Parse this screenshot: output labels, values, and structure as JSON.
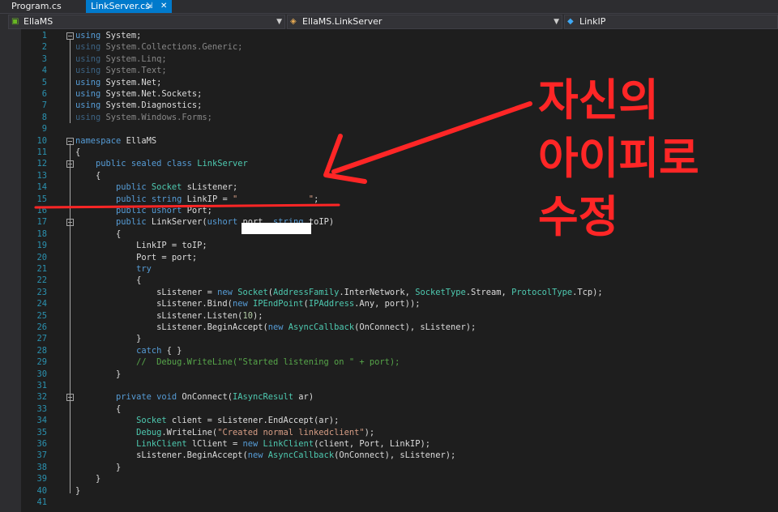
{
  "tabs": [
    {
      "label": "Program.cs",
      "active": false
    },
    {
      "label": "LinkServer.cs",
      "active": true
    }
  ],
  "nav": {
    "project": "EllaMS",
    "type": "EllaMS.LinkServer",
    "member": "LinkIP"
  },
  "lines": [
    {
      "n": "1",
      "html": "<span class=\"kw\">using</span> System;"
    },
    {
      "n": "2",
      "html": "<span class=\"dim\"><span class=\"kw\">using</span> System.Collections.Generic;</span>"
    },
    {
      "n": "3",
      "html": "<span class=\"dim\"><span class=\"kw\">using</span> System.Linq;</span>"
    },
    {
      "n": "4",
      "html": "<span class=\"dim\"><span class=\"kw\">using</span> System.Text;</span>"
    },
    {
      "n": "5",
      "html": "<span class=\"kw\">using</span> System.Net;"
    },
    {
      "n": "6",
      "html": "<span class=\"kw\">using</span> System.Net.Sockets;"
    },
    {
      "n": "7",
      "html": "<span class=\"kw\">using</span> System.Diagnostics;"
    },
    {
      "n": "8",
      "html": "<span class=\"dim\"><span class=\"kw\">using</span> System.Windows.Forms;</span>"
    },
    {
      "n": "9",
      "html": ""
    },
    {
      "n": "10",
      "html": "<span class=\"kw\">namespace</span> EllaMS"
    },
    {
      "n": "11",
      "html": "{"
    },
    {
      "n": "12",
      "html": "    <span class=\"kw\">public</span> <span class=\"kw\">sealed</span> <span class=\"kw\">class</span> <span class=\"ty\">LinkServer</span>"
    },
    {
      "n": "13",
      "html": "    {"
    },
    {
      "n": "14",
      "html": "        <span class=\"kw\">public</span> <span class=\"ty\">Socket</span> sListener;"
    },
    {
      "n": "15",
      "html": "        <span class=\"kw\">public</span> <span class=\"kw\">string</span> LinkIP = <span class=\"st\">\"              \"</span>;"
    },
    {
      "n": "16",
      "html": "        <span class=\"kw\">public</span> <span class=\"kw\">ushort</span> Port;"
    },
    {
      "n": "17",
      "html": "        <span class=\"kw\">public</span> LinkServer(<span class=\"kw\">ushort</span> port, <span class=\"kw\">string</span> toIP)"
    },
    {
      "n": "18",
      "html": "        {"
    },
    {
      "n": "19",
      "html": "            LinkIP = toIP;"
    },
    {
      "n": "20",
      "html": "            Port = port;"
    },
    {
      "n": "21",
      "html": "            <span class=\"kw\">try</span>"
    },
    {
      "n": "22",
      "html": "            {"
    },
    {
      "n": "23",
      "html": "                sListener = <span class=\"kw\">new</span> <span class=\"ty\">Socket</span>(<span class=\"ty\">AddressFamily</span>.InterNetwork, <span class=\"ty\">SocketType</span>.Stream, <span class=\"ty\">ProtocolType</span>.Tcp);"
    },
    {
      "n": "24",
      "html": "                sListener.Bind(<span class=\"kw\">new</span> <span class=\"ty\">IPEndPoint</span>(<span class=\"ty\">IPAddress</span>.Any, port));"
    },
    {
      "n": "25",
      "html": "                sListener.Listen(<span class=\"nm\">10</span>);"
    },
    {
      "n": "26",
      "html": "                sListener.BeginAccept(<span class=\"kw\">new</span> <span class=\"ty\">AsyncCallback</span>(OnConnect), sListener);"
    },
    {
      "n": "27",
      "html": "            }"
    },
    {
      "n": "28",
      "html": "            <span class=\"kw\">catch</span> { }"
    },
    {
      "n": "29",
      "html": "            <span class=\"cm\">//  Debug.WriteLine(\"Started listening on \" + port);</span>"
    },
    {
      "n": "30",
      "html": "        }"
    },
    {
      "n": "31",
      "html": ""
    },
    {
      "n": "32",
      "html": "        <span class=\"kw\">private</span> <span class=\"kw\">void</span> OnConnect(<span class=\"ty\">IAsyncResult</span> ar)"
    },
    {
      "n": "33",
      "html": "        {"
    },
    {
      "n": "34",
      "html": "            <span class=\"ty\">Socket</span> client = sListener.EndAccept(ar);"
    },
    {
      "n": "35",
      "html": "            <span class=\"ty\">Debug</span>.WriteLine(<span class=\"st\">\"Created normal linkedclient\"</span>);"
    },
    {
      "n": "36",
      "html": "            <span class=\"ty\">LinkClient</span> lClient = <span class=\"kw\">new</span> <span class=\"ty\">LinkClient</span>(client, Port, LinkIP);"
    },
    {
      "n": "37",
      "html": "            sListener.BeginAccept(<span class=\"kw\">new</span> <span class=\"ty\">AsyncCallback</span>(OnConnect), sListener);"
    },
    {
      "n": "38",
      "html": "        }"
    },
    {
      "n": "39",
      "html": "    }"
    },
    {
      "n": "40",
      "html": "}"
    },
    {
      "n": "41",
      "html": ""
    }
  ],
  "folds": [
    "1",
    "10",
    "12",
    "17",
    "32"
  ],
  "annotation": {
    "lines": [
      "자신의",
      "아이피로",
      "수정"
    ],
    "color": "#ff2626"
  },
  "colors": {
    "keyword": "#569cd6",
    "type": "#4ec9b0",
    "string": "#d69d85",
    "comment": "#57a64a",
    "line_number": "#2b91af",
    "active_tab": "#007acc"
  }
}
